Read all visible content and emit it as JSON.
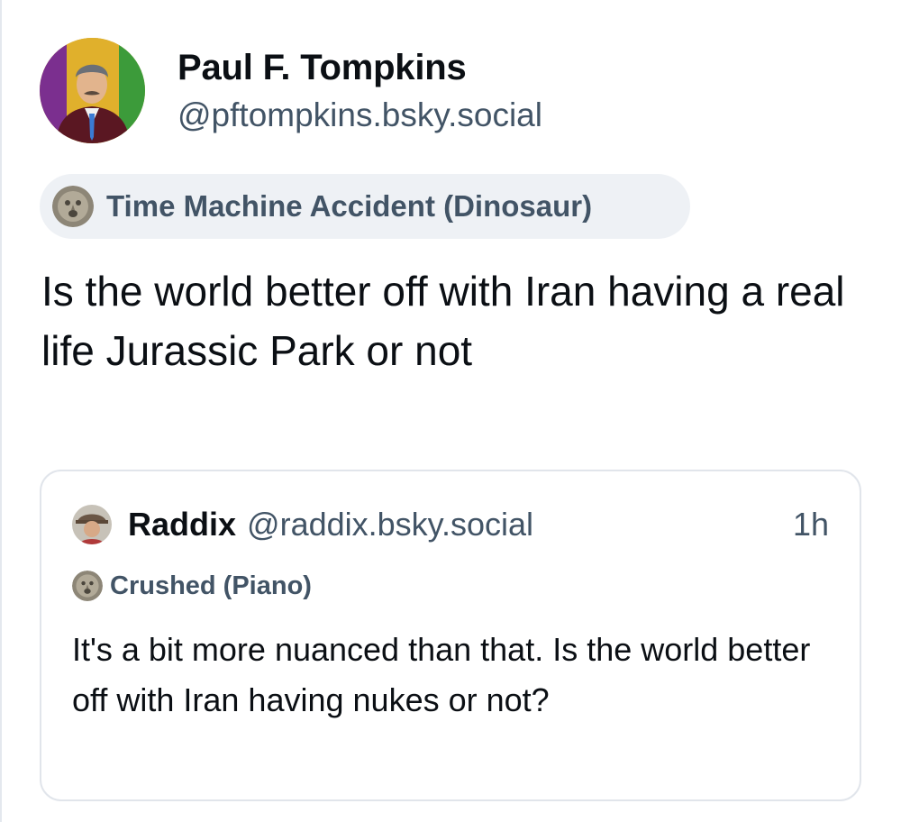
{
  "post": {
    "author": {
      "display_name": "Paul F. Tompkins",
      "handle": "@pftompkins.bsky.social",
      "avatar_icon": "avatar-man-in-suit"
    },
    "label": {
      "text": "Time Machine Accident (Dinosaur)",
      "icon": "stone-face-icon"
    },
    "text": "Is the world better off with Iran having a real life Jurassic Park or not"
  },
  "quote": {
    "author": {
      "display_name": "Raddix",
      "handle": "@raddix.bsky.social",
      "avatar_icon": "avatar-person-with-hat"
    },
    "time": "1h",
    "label": {
      "text": "Crushed (Piano)",
      "icon": "stone-face-icon"
    },
    "text": "It's a bit more nuanced than that. Is the world better off with Iran having nukes or not?"
  },
  "colors": {
    "text_primary": "#0b0f14",
    "text_secondary": "#425466",
    "pill_background": "#eef1f5",
    "border": "#e1e5eb"
  }
}
